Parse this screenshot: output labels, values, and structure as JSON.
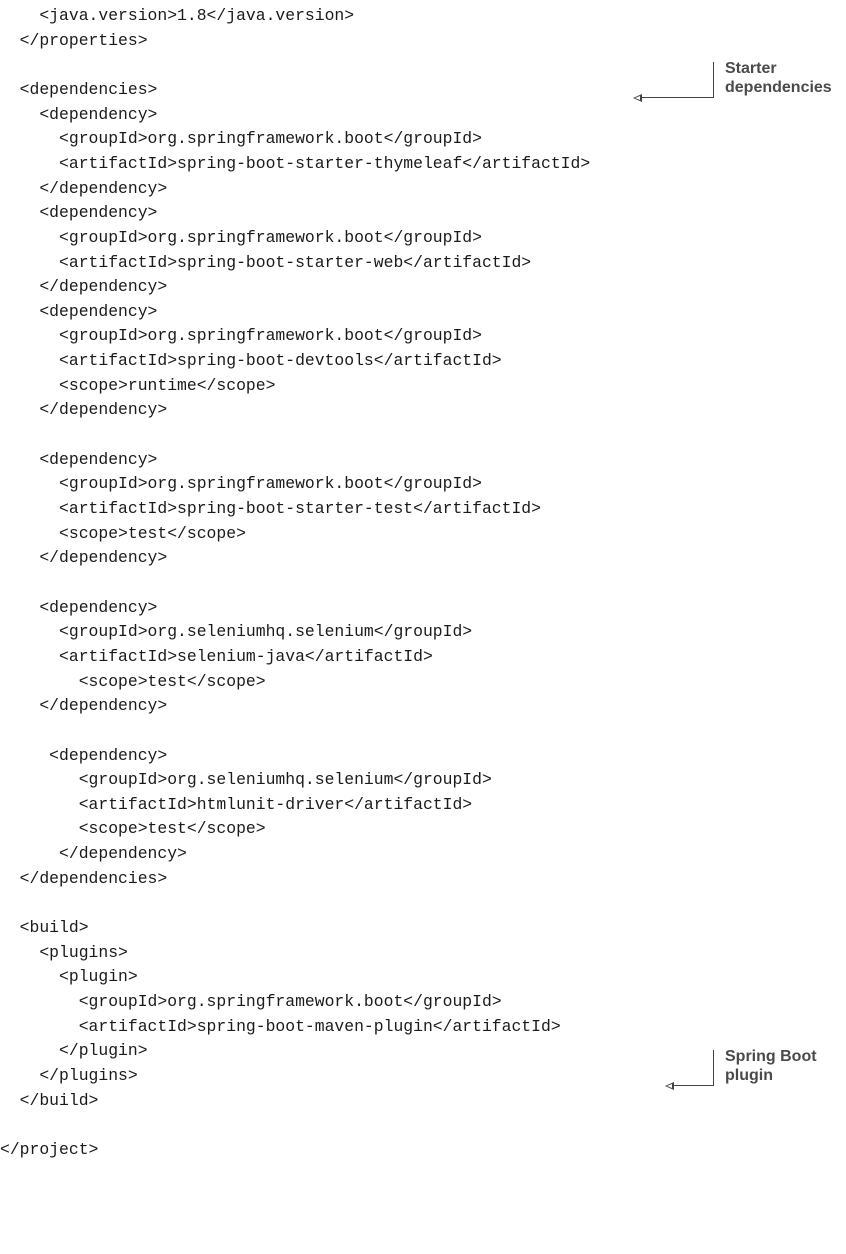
{
  "code_lines": [
    "    <java.version>1.8</java.version>",
    "  </properties>",
    "",
    "  <dependencies>",
    "    <dependency>",
    "      <groupId>org.springframework.boot</groupId>",
    "      <artifactId>spring-boot-starter-thymeleaf</artifactId>",
    "    </dependency>",
    "    <dependency>",
    "      <groupId>org.springframework.boot</groupId>",
    "      <artifactId>spring-boot-starter-web</artifactId>",
    "    </dependency>",
    "    <dependency>",
    "      <groupId>org.springframework.boot</groupId>",
    "      <artifactId>spring-boot-devtools</artifactId>",
    "      <scope>runtime</scope>",
    "    </dependency>",
    "",
    "    <dependency>",
    "      <groupId>org.springframework.boot</groupId>",
    "      <artifactId>spring-boot-starter-test</artifactId>",
    "      <scope>test</scope>",
    "    </dependency>",
    "",
    "    <dependency>",
    "      <groupId>org.seleniumhq.selenium</groupId>",
    "      <artifactId>selenium-java</artifactId>",
    "        <scope>test</scope>",
    "    </dependency>",
    "",
    "     <dependency>",
    "        <groupId>org.seleniumhq.selenium</groupId>",
    "        <artifactId>htmlunit-driver</artifactId>",
    "        <scope>test</scope>",
    "      </dependency>",
    "  </dependencies>",
    "",
    "  <build>",
    "    <plugins>",
    "      <plugin>",
    "        <groupId>org.springframework.boot</groupId>",
    "        <artifactId>spring-boot-maven-plugin</artifactId>",
    "      </plugin>",
    "    </plugins>",
    "  </build>",
    "",
    "</project>"
  ],
  "annotations": {
    "starter": "Starter\ndependencies",
    "plugin": "Spring Boot\nplugin"
  }
}
